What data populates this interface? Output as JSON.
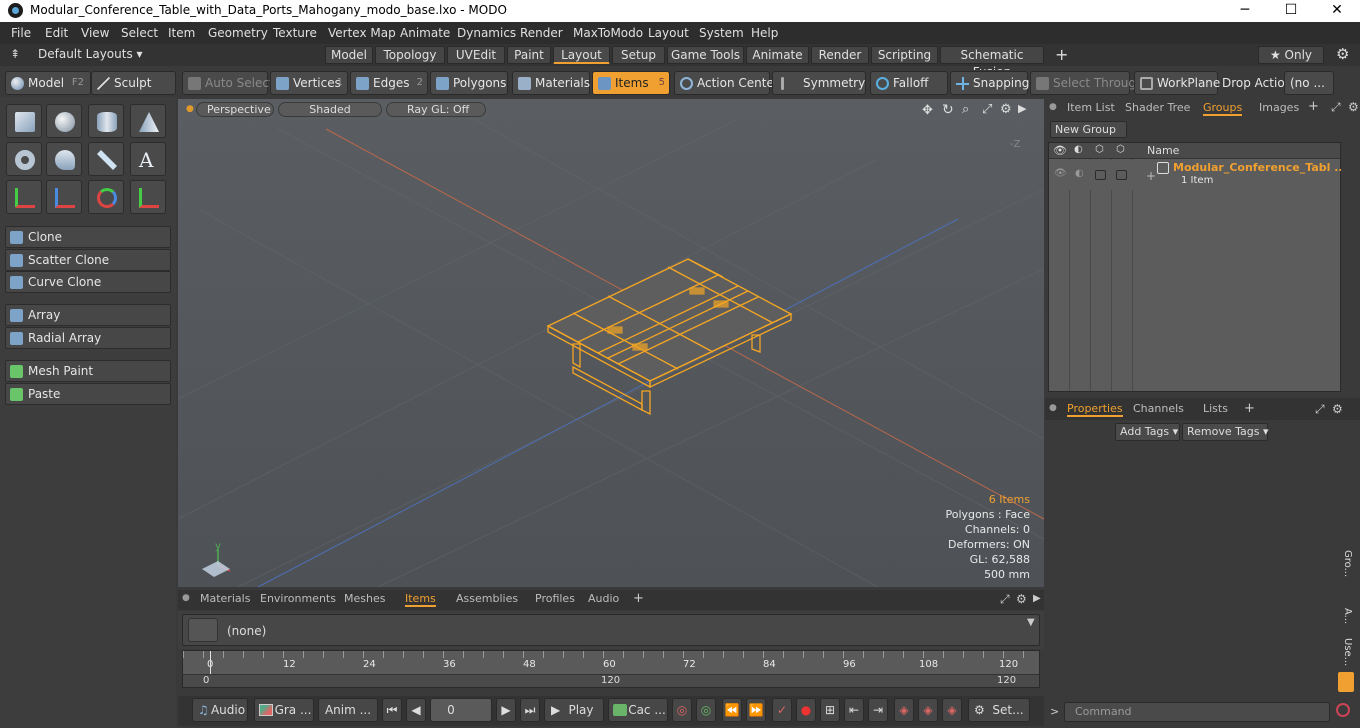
{
  "window": {
    "title": "Modular_Conference_Table_with_Data_Ports_Mahogany_modo_base.lxo - MODO",
    "minimize": "─",
    "maximize": "☐",
    "close": "✕"
  },
  "menu": [
    "File",
    "Edit",
    "View",
    "Select",
    "Item",
    "Geometry",
    "Texture",
    "Vertex Map",
    "Animate",
    "Dynamics",
    "Render",
    "MaxToModo",
    "Layout",
    "System",
    "Help"
  ],
  "layouts": {
    "default": "Default Layouts ▾",
    "tabs": [
      "Model",
      "Topology",
      "UVEdit",
      "Paint",
      "Layout",
      "Setup",
      "Game Tools",
      "Animate",
      "Render",
      "Scripting",
      "Schematic Fusion"
    ],
    "active": "Layout",
    "plus": "+",
    "only": "★  Only",
    "gear": "⚙"
  },
  "toolbar": {
    "model": "Model",
    "model_key": "F2",
    "sculpt": "Sculpt",
    "auto_select": "Auto Select",
    "vertices": "Vertices",
    "vertices_n": "1",
    "edges": "Edges",
    "edges_n": "2",
    "polygons": "Polygons",
    "materials": "Materials",
    "items": "Items",
    "items_n": "5",
    "action_center": "Action Center",
    "symmetry": "Symmetry",
    "falloff": "Falloff",
    "snapping": "Snapping",
    "select_through": "Select Through",
    "workplane": "WorkPlane",
    "drop_action": "Drop Action",
    "drop_value": "(no ..."
  },
  "left": {
    "clone": "Clone",
    "scatter_clone": "Scatter Clone",
    "curve_clone": "Curve Clone",
    "array": "Array",
    "radial_array": "Radial Array",
    "mesh_paint": "Mesh Paint",
    "paste": "Paste"
  },
  "viewport": {
    "perspective": "Perspective",
    "shaded": "Shaded",
    "raygl": "Ray GL: Off",
    "axis_label": "-Z",
    "info": {
      "items": "6 Items",
      "polygons": "Polygons : Face",
      "channels": "Channels: 0",
      "deformers": "Deformers: ON",
      "gl": "GL: 62,588",
      "scale": "500 mm"
    }
  },
  "bottom_tabs": [
    "Materials",
    "Environments",
    "Meshes",
    "Items",
    "Assemblies",
    "Profiles",
    "Audio"
  ],
  "bottom_active": "Items",
  "item_selector": "(none)",
  "timeline": {
    "ticks": [
      "0",
      "12",
      "24",
      "36",
      "48",
      "60",
      "72",
      "84",
      "96",
      "108",
      "120"
    ],
    "lower": [
      "0",
      "120",
      "120"
    ]
  },
  "transport": {
    "audio": "Audio",
    "graph": "Gra ...",
    "anim": "Anim ...",
    "frame": "0",
    "play": "Play",
    "cache": "Cac ...",
    "settings": "Set..."
  },
  "right": {
    "tabs": [
      "Item List",
      "Shader Tree",
      "Groups",
      "Images"
    ],
    "active": "Groups",
    "new_group": "New Group",
    "col_name": "Name",
    "group_name": "Modular_Conference_Tabl ...",
    "group_count": "1 Item",
    "prop_tabs": [
      "Properties",
      "Channels",
      "Lists"
    ],
    "prop_active": "Properties",
    "add_tags": "Add Tags ▾",
    "remove_tags": "Remove Tags ▾",
    "side_labels": [
      "Gro...",
      "A...",
      "Use..."
    ],
    "command": "Command"
  },
  "colors": {
    "accent": "#f0a030",
    "wire": "#f5a623"
  }
}
